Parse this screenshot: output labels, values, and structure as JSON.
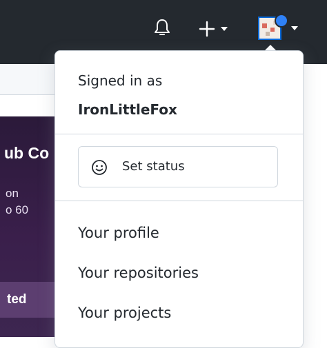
{
  "header": {
    "notifications_icon": "bell-icon",
    "create_icon": "plus-icon",
    "colors": {
      "background": "#24292f",
      "focus": "#0969da"
    }
  },
  "background_page": {
    "hero_title": "ub Co",
    "hero_line1": "on",
    "hero_line2": "o 60",
    "hero_button": "ted"
  },
  "dropdown": {
    "signed_in_label": "Signed in as",
    "username": "IronLittleFox",
    "set_status_label": "Set status",
    "items": [
      {
        "label": "Your profile"
      },
      {
        "label": "Your repositories"
      },
      {
        "label": "Your projects"
      }
    ]
  }
}
